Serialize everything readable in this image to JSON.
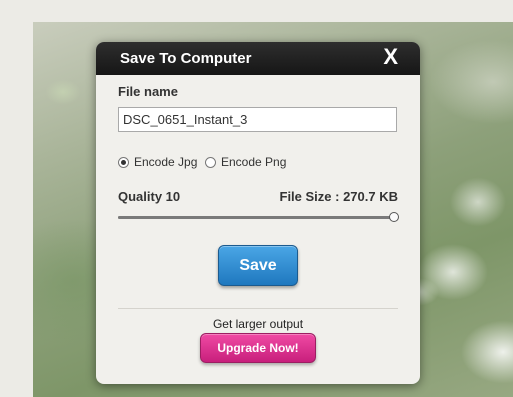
{
  "dialog": {
    "title": "Save To Computer",
    "close_label": "X",
    "file_name_label": "File name",
    "file_name_value": "DSC_0651_Instant_3",
    "encode_options": [
      {
        "label": "Encode Jpg",
        "checked": true
      },
      {
        "label": "Encode Png",
        "checked": false
      }
    ],
    "quality_label": "Quality 10",
    "file_size_label": "File Size : 270.7 KB",
    "quality_slider_fraction": 1.0,
    "save_label": "Save",
    "larger_output_text": "Get larger output",
    "upgrade_label": "Upgrade Now!"
  },
  "colors": {
    "titlebar": "#1e1e1e",
    "save_button": "#2a8ad4",
    "upgrade_button": "#e0338f"
  },
  "icons": {
    "close": "close-icon"
  }
}
